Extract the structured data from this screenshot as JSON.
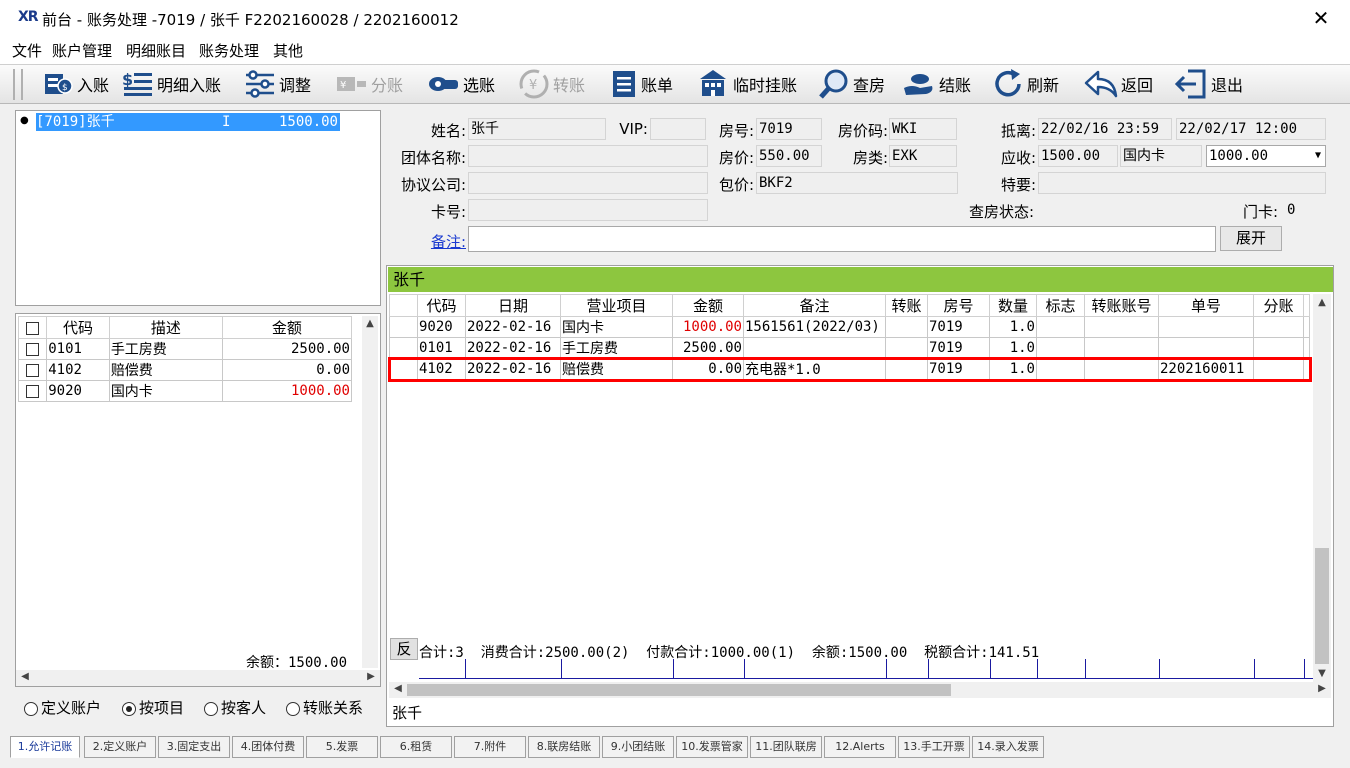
{
  "window": {
    "logo": "XR",
    "title": "前台 - 账务处理 -7019 / 张千  F2202160028 / 2202160012",
    "close": "✕"
  },
  "menu": [
    "文件",
    "账户管理",
    "明细账目",
    "账务处理",
    "其他"
  ],
  "toolbar": [
    {
      "label": "入账",
      "icon": "ledger-in-icon",
      "enabled": true
    },
    {
      "label": "明细入账",
      "icon": "detail-list-icon",
      "enabled": true
    },
    {
      "label": "调整",
      "icon": "sliders-icon",
      "enabled": true
    },
    {
      "label": "分账",
      "icon": "split-icon",
      "enabled": false
    },
    {
      "label": "选账",
      "icon": "select-account-icon",
      "enabled": true
    },
    {
      "label": "转账",
      "icon": "transfer-icon",
      "enabled": false
    },
    {
      "label": "账单",
      "icon": "bill-icon",
      "enabled": true
    },
    {
      "label": "临时挂账",
      "icon": "building-icon",
      "enabled": true
    },
    {
      "label": "查房",
      "icon": "magnifier-icon",
      "enabled": true
    },
    {
      "label": "结账",
      "icon": "checkout-hand-icon",
      "enabled": true
    },
    {
      "label": "刷新",
      "icon": "refresh-icon",
      "enabled": true
    },
    {
      "label": "返回",
      "icon": "back-arrow-icon",
      "enabled": true
    },
    {
      "label": "退出",
      "icon": "exit-icon",
      "enabled": true
    }
  ],
  "accounts_tree": {
    "item": "[7019]张千",
    "flag": "I",
    "amount": "1500.00"
  },
  "left_table": {
    "headers": [
      "代码",
      "描述",
      "金额"
    ],
    "rows": [
      {
        "code": "0101",
        "desc": "手工房费",
        "amount": "2500.00",
        "red": false
      },
      {
        "code": "4102",
        "desc": "赔偿费",
        "amount": "0.00",
        "red": false
      },
      {
        "code": "9020",
        "desc": "国内卡",
        "amount": "1000.00",
        "red": true
      }
    ],
    "balance_label": "余额：",
    "balance": "1500.00"
  },
  "view_options": [
    {
      "label": "定义账户",
      "selected": false
    },
    {
      "label": "按项目",
      "selected": true
    },
    {
      "label": "按客人",
      "selected": false
    },
    {
      "label": "转账关系",
      "selected": false
    }
  ],
  "guest": {
    "name_label": "姓名:",
    "name": "张千",
    "vip_label": "VIP:",
    "vip": "",
    "room_label": "房号:",
    "room": "7019",
    "rate_code_label": "房价码:",
    "rate_code": "WKI",
    "arrive_depart_label": "抵离:",
    "arrive": "22/02/16 23:59",
    "depart": "22/02/17 12:00",
    "group_label": "团体名称:",
    "group": "",
    "price_label": "房价:",
    "price": "550.00",
    "room_type_label": "房类:",
    "room_type": "EXK",
    "receivable_label": "应收:",
    "receivable": "1500.00",
    "pay_method": "国内卡",
    "pay_amount": "1000.00",
    "company_label": "协议公司:",
    "company": "",
    "package_label": "包价:",
    "package": "BKF2",
    "special_label": "特要:",
    "special": "",
    "card_label": "卡号:",
    "card": "",
    "check_status_label": "查房状态:",
    "door_card_label": "门卡:",
    "door_card": "0",
    "remark_label": "备注:",
    "remark": "",
    "expand_button": "展开"
  },
  "ledger": {
    "header_name": "张千",
    "columns": [
      "代码",
      "日期",
      "营业项目",
      "金额",
      "备注",
      "转账",
      "房号",
      "数量",
      "标志",
      "转账账号",
      "单号",
      "分账"
    ],
    "rows": [
      {
        "code": "9020",
        "date": "2022-02-16",
        "item": "国内卡",
        "amount": "1000.00",
        "red": true,
        "remark": "1561561(2022/03)",
        "transfer": "",
        "room": "7019",
        "qty": "1.0",
        "flag": "",
        "transfer_acct": "",
        "bill_no": "",
        "split": ""
      },
      {
        "code": "0101",
        "date": "2022-02-16",
        "item": "手工房费",
        "amount": "2500.00",
        "red": false,
        "remark": "",
        "transfer": "",
        "room": "7019",
        "qty": "1.0",
        "flag": "",
        "transfer_acct": "",
        "bill_no": "",
        "split": ""
      },
      {
        "code": "4102",
        "date": "2022-02-16",
        "item": "赔偿费",
        "amount": "0.00",
        "red": false,
        "remark": "充电器*1.0",
        "transfer": "",
        "room": "7019",
        "qty": "1.0",
        "flag": "",
        "transfer_acct": "",
        "bill_no": "2202160011",
        "split": ""
      }
    ],
    "reverse_button": "反",
    "summary": "合计:3  消费合计:2500.00(2)  付款合计:1000.00(1)  余额:1500.00  税额合计:141.51",
    "footer_tab": "张千"
  },
  "bottom_tabs": [
    "1.允许记账",
    "2.定义账户",
    "3.固定支出",
    "4.团体付费",
    "5.发票",
    "6.租赁",
    "7.附件",
    "8.联房结账",
    "9.小团结账",
    "10.发票管家",
    "11.团队联房",
    "12.Alerts",
    "13.手工开票",
    "14.录入发票"
  ],
  "colors": {
    "highlight_border": "#ff0000",
    "ledger_header": "#8dc63f",
    "selection": "#3399ff",
    "negative_amount": "#e00000"
  }
}
